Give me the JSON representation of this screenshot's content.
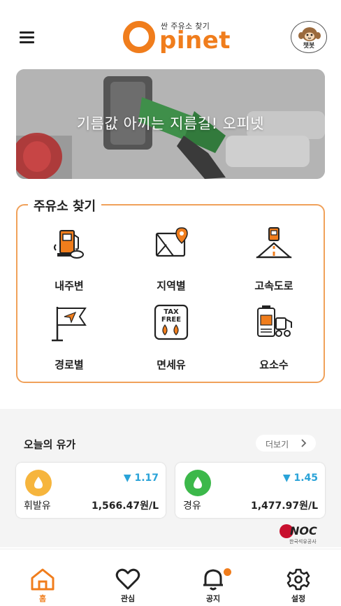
{
  "header": {
    "logo_tagline": "싼 주유소 찾기",
    "logo_text": "pinet",
    "chatbot_label": "챗봇"
  },
  "banner": {
    "text": "기름값 아끼는 지름길! 오피넷"
  },
  "finder": {
    "title": "주유소 찾기",
    "items": [
      {
        "label": "내주변",
        "icon": "gas-station-icon"
      },
      {
        "label": "지역별",
        "icon": "map-pin-icon"
      },
      {
        "label": "고속도로",
        "icon": "highway-icon"
      },
      {
        "label": "경로별",
        "icon": "route-flag-icon"
      },
      {
        "label": "면세유",
        "icon": "tax-free-icon"
      },
      {
        "label": "요소수",
        "icon": "urea-icon"
      }
    ],
    "tax_free_lines": [
      "TAX",
      "FREE"
    ]
  },
  "today": {
    "title": "오늘의 유가",
    "more_label": "더보기",
    "prices": [
      {
        "name": "휘발유",
        "change": "▼ 1.17",
        "value": "1,566.47원/L",
        "color": "#f6b53d"
      },
      {
        "name": "경유",
        "change": "▼ 1.45",
        "value": "1,477.97원/L",
        "color": "#3cb84a"
      }
    ],
    "knoc": {
      "brand": "NOC",
      "sub": "한국석유공사"
    }
  },
  "nav": {
    "items": [
      {
        "label": "홈",
        "icon": "home-icon"
      },
      {
        "label": "관심",
        "icon": "heart-icon"
      },
      {
        "label": "공지",
        "icon": "bell-icon"
      },
      {
        "label": "설정",
        "icon": "gear-icon"
      }
    ]
  },
  "colors": {
    "accent": "#f07d1c",
    "price_down": "#2aa3d8"
  }
}
